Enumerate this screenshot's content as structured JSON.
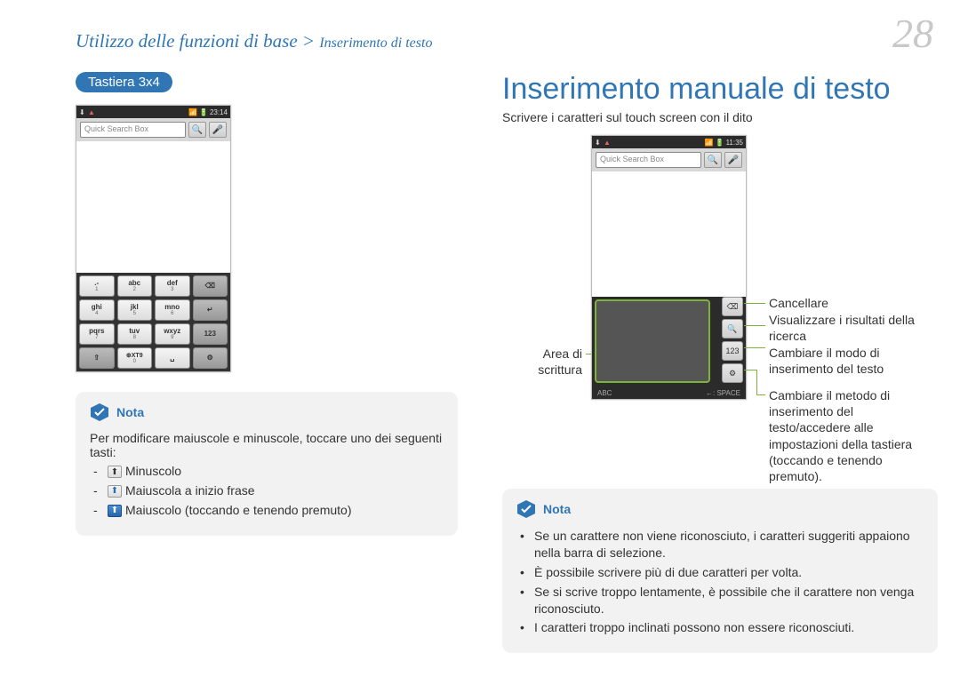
{
  "header": {
    "breadcrumb_main": "Utilizzo delle funzioni di base",
    "breadcrumb_sep": " > ",
    "breadcrumb_sub": "Inserimento di testo",
    "page_number": "28"
  },
  "left": {
    "pill": "Tastiera 3x4",
    "phone": {
      "time": "23:14",
      "search_placeholder": "Quick Search Box",
      "keypad": [
        [
          {
            "main": ".-",
            "sub": "1"
          },
          {
            "main": "abc",
            "sub": "2"
          },
          {
            "main": "def",
            "sub": "3"
          },
          {
            "main": "⌫",
            "sub": ""
          }
        ],
        [
          {
            "main": "ghi",
            "sub": "4"
          },
          {
            "main": "jkl",
            "sub": "5"
          },
          {
            "main": "mno",
            "sub": "6"
          },
          {
            "main": "↵",
            "sub": ""
          }
        ],
        [
          {
            "main": "pqrs",
            "sub": "7"
          },
          {
            "main": "tuv",
            "sub": "8"
          },
          {
            "main": "wxyz",
            "sub": "9"
          },
          {
            "main": "123",
            "sub": ""
          }
        ],
        [
          {
            "main": "⇧",
            "sub": ""
          },
          {
            "main": "⊕XT9",
            "sub": "0"
          },
          {
            "main": "␣",
            "sub": ""
          },
          {
            "main": "⚙",
            "sub": ""
          }
        ]
      ]
    },
    "note": {
      "title": "Nota",
      "intro": "Per modificare maiuscole e minuscole, toccare uno dei seguenti tasti:",
      "items": [
        "Minuscolo",
        "Maiuscola a inizio frase",
        "Maiuscolo (toccando e tenendo premuto)"
      ]
    }
  },
  "right": {
    "title": "Inserimento manuale di testo",
    "subtitle": "Scrivere i caratteri sul touch screen con il dito",
    "phone": {
      "time": "11:35",
      "search_placeholder": "Quick Search Box",
      "side_buttons": [
        "⌫",
        "🔍",
        "123",
        "⚙"
      ],
      "footer_left": "ABC",
      "footer_right": "←: SPACE"
    },
    "annotations": {
      "write_area": "Area di scrittura",
      "delete": "Cancellare",
      "search": "Visualizzare i risultati della ricerca",
      "mode": "Cambiare il modo di inserimento del testo",
      "settings": "Cambiare il metodo di inserimento del testo/accedere alle impostazioni della tastiera (toccando e tenendo premuto)."
    },
    "note": {
      "title": "Nota",
      "items": [
        "Se un carattere non viene riconosciuto, i caratteri suggeriti appaiono nella barra di selezione.",
        "È possibile scrivere più di due caratteri per volta.",
        "Se si scrive troppo lentamente, è possibile che il carattere non venga riconosciuto.",
        "I caratteri troppo inclinati possono non essere riconosciuti."
      ]
    }
  }
}
